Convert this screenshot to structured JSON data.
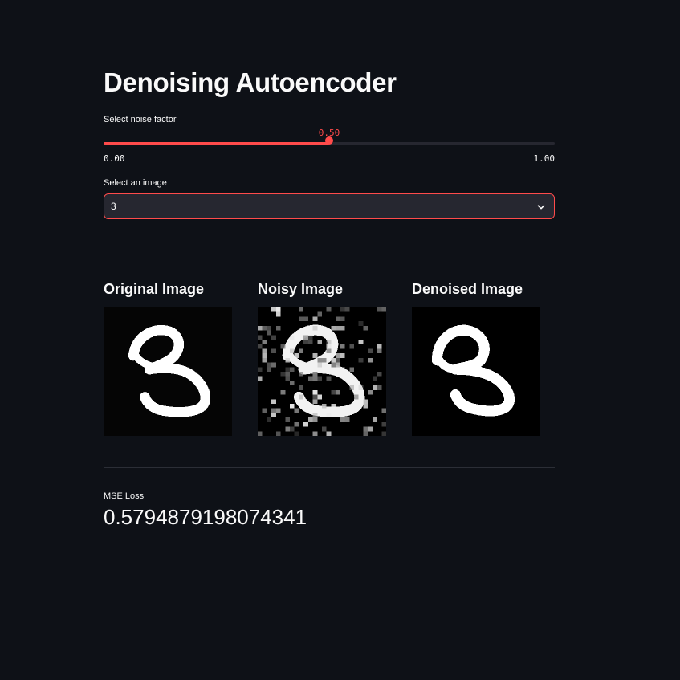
{
  "page": {
    "title": "Denoising Autoencoder"
  },
  "noise_slider": {
    "label": "Select noise factor",
    "value": 0.5,
    "value_text": "0.50",
    "min": 0,
    "max": 1,
    "min_text": "0.00",
    "max_text": "1.00",
    "accent_color": "#ff4b4b"
  },
  "image_select": {
    "label": "Select an image",
    "value": "3",
    "icon": "chevron-down-icon"
  },
  "images": {
    "original": {
      "heading": "Original Image"
    },
    "noisy": {
      "heading": "Noisy Image"
    },
    "denoised": {
      "heading": "Denoised Image"
    }
  },
  "metric": {
    "label": "MSE Loss",
    "value": "0.5794879198074341"
  },
  "colors": {
    "background": "#0e1117",
    "text": "#fafafa",
    "widget_background": "#262730",
    "accent": "#ff4b4b"
  }
}
